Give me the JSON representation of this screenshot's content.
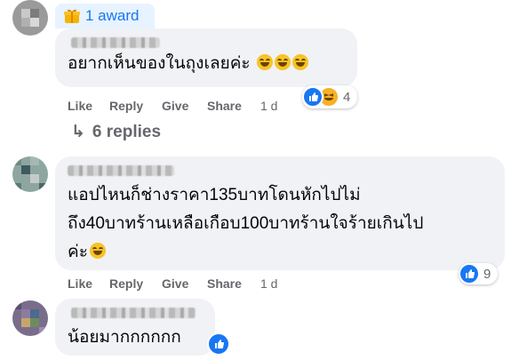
{
  "award": {
    "label": "1 award"
  },
  "comments": [
    {
      "text": "อยากเห็นของในถุงเลยค่ะ",
      "reaction_count": "4",
      "actions": {
        "like": "Like",
        "reply": "Reply",
        "give": "Give",
        "share": "Share",
        "time": "1 d"
      }
    },
    {
      "text_lines": [
        "แอปไหนก็ช่างราคา135บาทโดนหักไปไม่",
        "ถึง40บาทร้านเหลือเกือบ100บาทร้านใจร้ายเกินไป",
        "ค่ะ"
      ],
      "reaction_count": "9",
      "actions": {
        "like": "Like",
        "reply": "Reply",
        "give": "Give",
        "share": "Share",
        "time": "1 d"
      }
    },
    {
      "text": "น้อยมากกกกกก"
    }
  ],
  "replies": {
    "arrow": "↳",
    "label": "6 replies"
  },
  "colors": {
    "accent": "#1877f2",
    "bubble": "#f0f2f5",
    "muted": "#65676b"
  }
}
